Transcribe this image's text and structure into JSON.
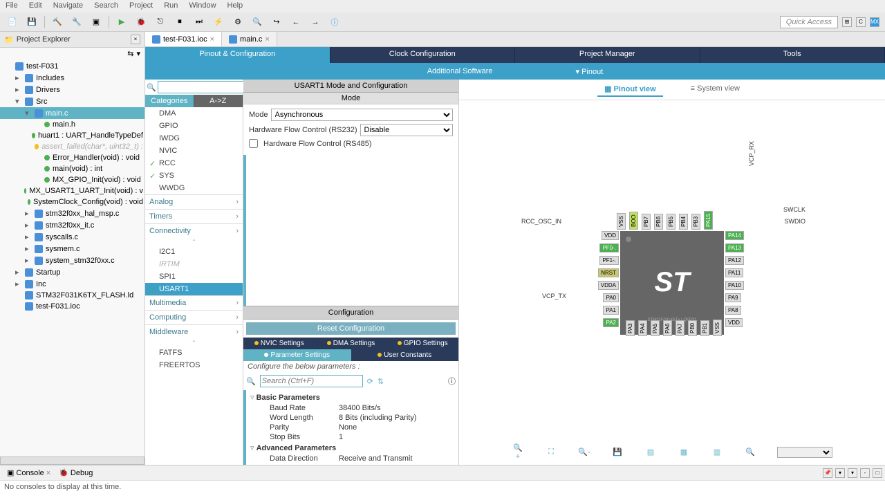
{
  "menu": [
    "File",
    "Edit",
    "Navigate",
    "Search",
    "Project",
    "Run",
    "Window",
    "Help"
  ],
  "quick_access": "Quick Access",
  "project_explorer": {
    "title": "Project Explorer"
  },
  "tree": [
    {
      "label": "test-F031",
      "lvl": 0,
      "exp": true
    },
    {
      "label": "Includes",
      "lvl": 1,
      "exp": false,
      "arrow": "▸"
    },
    {
      "label": "Drivers",
      "lvl": 1,
      "exp": false,
      "arrow": "▸"
    },
    {
      "label": "Src",
      "lvl": 1,
      "exp": true,
      "arrow": "▾"
    },
    {
      "label": "main.c",
      "lvl": 2,
      "selected": true,
      "arrow": "▾"
    },
    {
      "label": "main.h",
      "lvl": 3,
      "dot": "blue"
    },
    {
      "label": "huart1 : UART_HandleTypeDef",
      "lvl": 3,
      "dot": "blue"
    },
    {
      "label": "assert_failed(char*, uint32_t) :",
      "lvl": 3,
      "dot": "yellow",
      "dim": true
    },
    {
      "label": "Error_Handler(void) : void",
      "lvl": 3,
      "dot": "blue"
    },
    {
      "label": "main(void) : int",
      "lvl": 3,
      "dot": "blue"
    },
    {
      "label": "MX_GPIO_Init(void) : void",
      "lvl": 3,
      "dot": "blue"
    },
    {
      "label": "MX_USART1_UART_Init(void) : v",
      "lvl": 3,
      "dot": "blue"
    },
    {
      "label": "SystemClock_Config(void) : void",
      "lvl": 3,
      "dot": "blue"
    },
    {
      "label": "stm32f0xx_hal_msp.c",
      "lvl": 2,
      "arrow": "▸"
    },
    {
      "label": "stm32f0xx_it.c",
      "lvl": 2,
      "arrow": "▸"
    },
    {
      "label": "syscalls.c",
      "lvl": 2,
      "arrow": "▸"
    },
    {
      "label": "sysmem.c",
      "lvl": 2,
      "arrow": "▸"
    },
    {
      "label": "system_stm32f0xx.c",
      "lvl": 2,
      "arrow": "▸"
    },
    {
      "label": "Startup",
      "lvl": 1,
      "arrow": "▸"
    },
    {
      "label": "Inc",
      "lvl": 1,
      "arrow": "▸"
    },
    {
      "label": "STM32F031K6TX_FLASH.ld",
      "lvl": 1
    },
    {
      "label": "test-F031.ioc",
      "lvl": 1
    }
  ],
  "editor_tabs": [
    {
      "label": "test-F031.ioc",
      "active": true
    },
    {
      "label": "main.c",
      "active": false
    }
  ],
  "config_tabs": [
    "Pinout & Configuration",
    "Clock Configuration",
    "Project Manager",
    "Tools"
  ],
  "config_sub": {
    "software": "Additional Software",
    "pinout": "Pinout"
  },
  "cat_tabs": [
    "Categories",
    "A->Z"
  ],
  "categories": {
    "core": [
      "DMA",
      "GPIO",
      "IWDG",
      "NVIC",
      "RCC",
      "SYS",
      "WWDG"
    ],
    "sections1": [
      "Analog",
      "Timers",
      "Connectivity"
    ],
    "conn": [
      {
        "label": "I2C1"
      },
      {
        "label": "IRTIM",
        "dim": true
      },
      {
        "label": "SPI1"
      },
      {
        "label": "USART1",
        "sel": true,
        "chk": true
      }
    ],
    "sections2": [
      "Multimedia",
      "Computing",
      "Middleware"
    ],
    "mw": [
      "FATFS",
      "FREERTOS"
    ]
  },
  "mode_panel": {
    "title": "USART1 Mode and Configuration",
    "mode_header": "Mode",
    "mode_label": "Mode",
    "mode_value": "Asynchronous",
    "hw_flow_label": "Hardware Flow Control (RS232)",
    "hw_flow_value": "Disable",
    "rs485_label": "Hardware Flow Control (RS485)",
    "config_header": "Configuration",
    "reset": "Reset Configuration",
    "settings_tabs": [
      "NVIC Settings",
      "DMA Settings",
      "GPIO Settings"
    ],
    "settings_tabs2": [
      "Parameter Settings",
      "User Constants"
    ],
    "configure_label": "Configure the below parameters :",
    "search_ph": "Search (Ctrl+F)"
  },
  "params": [
    {
      "group": "Basic Parameters"
    },
    {
      "name": "Baud Rate",
      "val": "38400 Bits/s"
    },
    {
      "name": "Word Length",
      "val": "8 Bits (including Parity)"
    },
    {
      "name": "Parity",
      "val": "None"
    },
    {
      "name": "Stop Bits",
      "val": "1"
    },
    {
      "group": "Advanced Parameters"
    },
    {
      "name": "Data Direction",
      "val": "Receive and Transmit"
    }
  ],
  "pinout": {
    "view": "Pinout view",
    "system": "System view",
    "logo": "ST",
    "chip_sub": "STM32F031K6Tx  LQFP32",
    "labels": {
      "rcc": "RCC_OSC_IN",
      "vcp_tx": "VCP_TX",
      "vcp_rx": "VCP_RX",
      "swclk": "SWCLK",
      "swdio": "SWDIO"
    }
  },
  "console": {
    "tab1": "Console",
    "tab2": "Debug",
    "empty": "No consoles to display at this time."
  }
}
